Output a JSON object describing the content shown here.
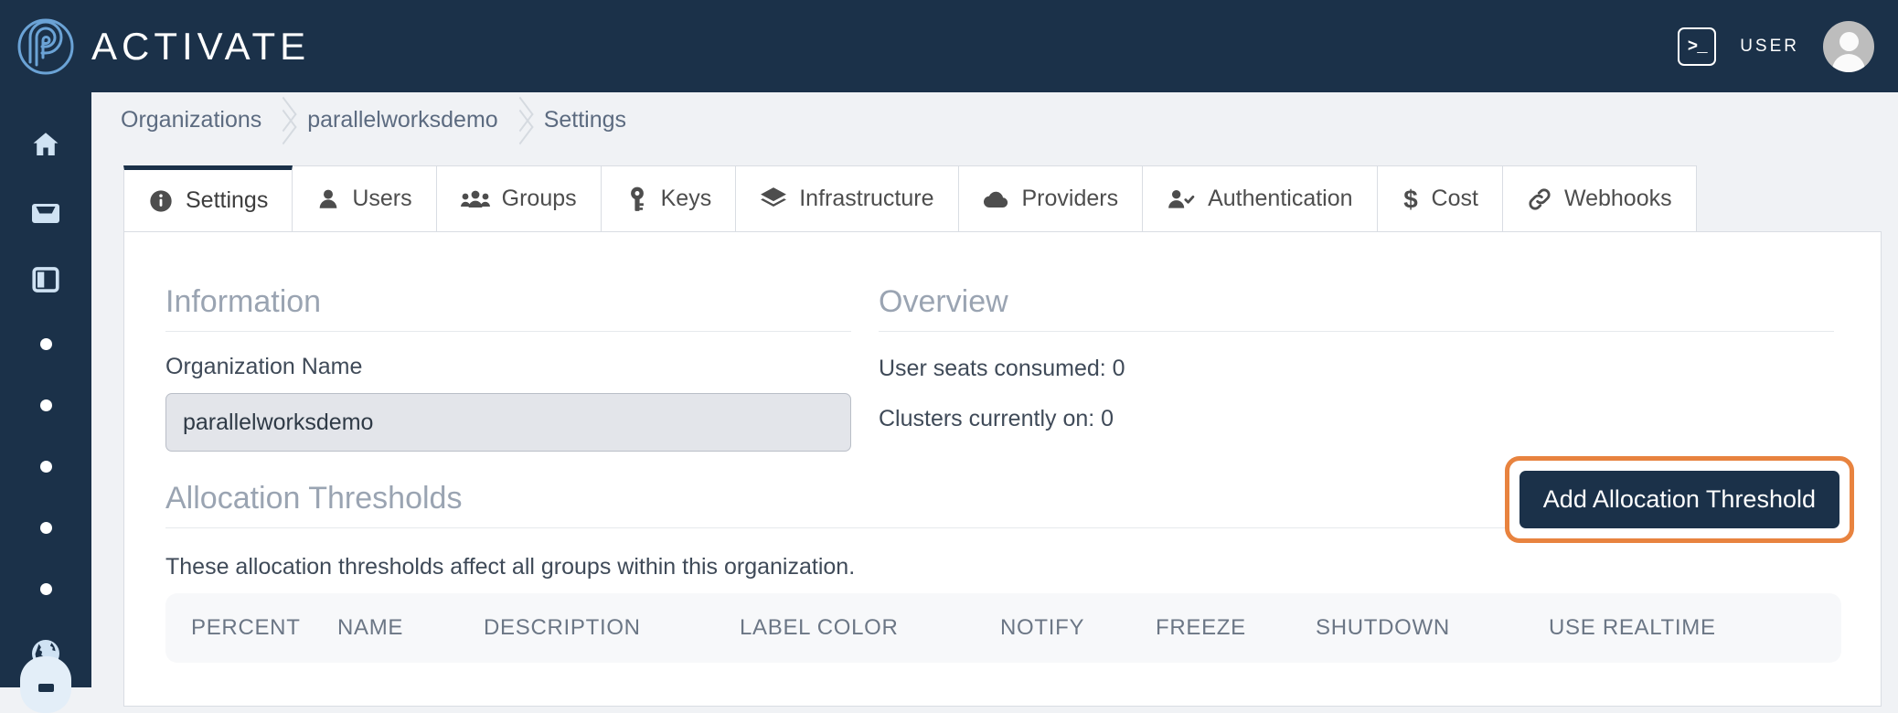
{
  "header": {
    "brand_name": "ACTIVATE",
    "logo_icon": "spiral-fingerprint-logo",
    "terminal_icon": ">_",
    "user_label": "USER",
    "avatar_icon": "user-avatar"
  },
  "sidebar": {
    "items": [
      {
        "icon": "home-icon",
        "name": "home"
      },
      {
        "icon": "inbox-icon",
        "name": "inbox"
      },
      {
        "icon": "panel-icon",
        "name": "panel"
      },
      {
        "icon": "dot-icon",
        "name": "dot-1"
      },
      {
        "icon": "dot-icon",
        "name": "dot-2"
      },
      {
        "icon": "dot-icon",
        "name": "dot-3"
      },
      {
        "icon": "dot-icon",
        "name": "dot-4"
      },
      {
        "icon": "dot-icon",
        "name": "dot-5"
      },
      {
        "icon": "globe-icon",
        "name": "globe"
      }
    ]
  },
  "breadcrumb": {
    "items": [
      "Organizations",
      "parallelworksdemo",
      "Settings"
    ]
  },
  "tabs": [
    {
      "label": "Settings",
      "icon": "info-circle-icon",
      "active": true
    },
    {
      "label": "Users",
      "icon": "user-icon",
      "active": false
    },
    {
      "label": "Groups",
      "icon": "users-group-icon",
      "active": false
    },
    {
      "label": "Keys",
      "icon": "key-icon",
      "active": false
    },
    {
      "label": "Infrastructure",
      "icon": "layers-icon",
      "active": false
    },
    {
      "label": "Providers",
      "icon": "cloud-icon",
      "active": false
    },
    {
      "label": "Authentication",
      "icon": "user-check-icon",
      "active": false
    },
    {
      "label": "Cost",
      "icon": "dollar-icon",
      "active": false
    },
    {
      "label": "Webhooks",
      "icon": "link-icon",
      "active": false
    }
  ],
  "information": {
    "heading": "Information",
    "org_name_label": "Organization Name",
    "org_name_value": "parallelworksdemo",
    "org_name_placeholder": "Organization Name"
  },
  "overview": {
    "heading": "Overview",
    "lines": [
      "User seats consumed: 0",
      "Clusters currently on: 0"
    ]
  },
  "allocation": {
    "heading": "Allocation Thresholds",
    "add_button_label": "Add Allocation Threshold",
    "description": "These allocation thresholds affect all groups within this organization.",
    "columns": [
      "PERCENT",
      "NAME",
      "DESCRIPTION",
      "LABEL COLOR",
      "NOTIFY",
      "FREEZE",
      "SHUTDOWN",
      "USE REALTIME"
    ],
    "rows": []
  },
  "colors": {
    "brand_navy": "#1b3149",
    "logo_blue": "#6ba3d6",
    "highlight_orange": "#e8833f",
    "page_background": "#f0f2f5",
    "card_background": "#ffffff",
    "heading_grey": "#9aa4b2"
  }
}
